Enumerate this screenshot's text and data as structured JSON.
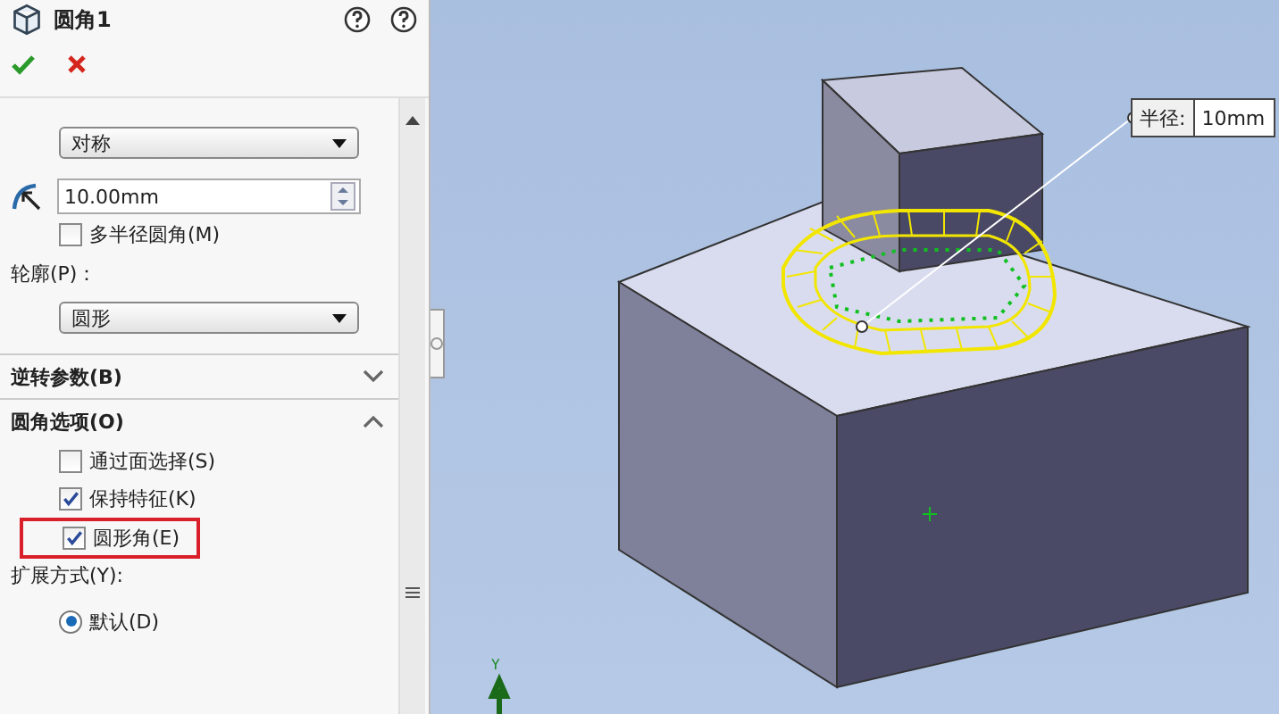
{
  "header": {
    "title": "圆角1"
  },
  "fillet_type": {
    "value": "对称"
  },
  "radius": {
    "value": "10.00mm"
  },
  "multi_radius": {
    "label": "多半径圆角(M)",
    "checked": false
  },
  "profile": {
    "label": "轮廓(P)：",
    "value": "圆形"
  },
  "sections": [
    {
      "title": "逆转参数(B)",
      "expanded": false
    },
    {
      "title": "圆角选项(O)",
      "expanded": true
    }
  ],
  "options": [
    {
      "label": "通过面选择(S)",
      "checked": false,
      "highlighted": false
    },
    {
      "label": "保持特征(K)",
      "checked": true,
      "highlighted": false
    },
    {
      "label": "圆形角(E)",
      "checked": true,
      "highlighted": true
    }
  ],
  "spread": {
    "label": "扩展方式(Y):"
  },
  "spread_options": [
    {
      "label": "默认(D)",
      "selected": true
    }
  ],
  "callout": {
    "label": "半径:",
    "value": "10mm"
  },
  "axis": {
    "label": "Y"
  }
}
